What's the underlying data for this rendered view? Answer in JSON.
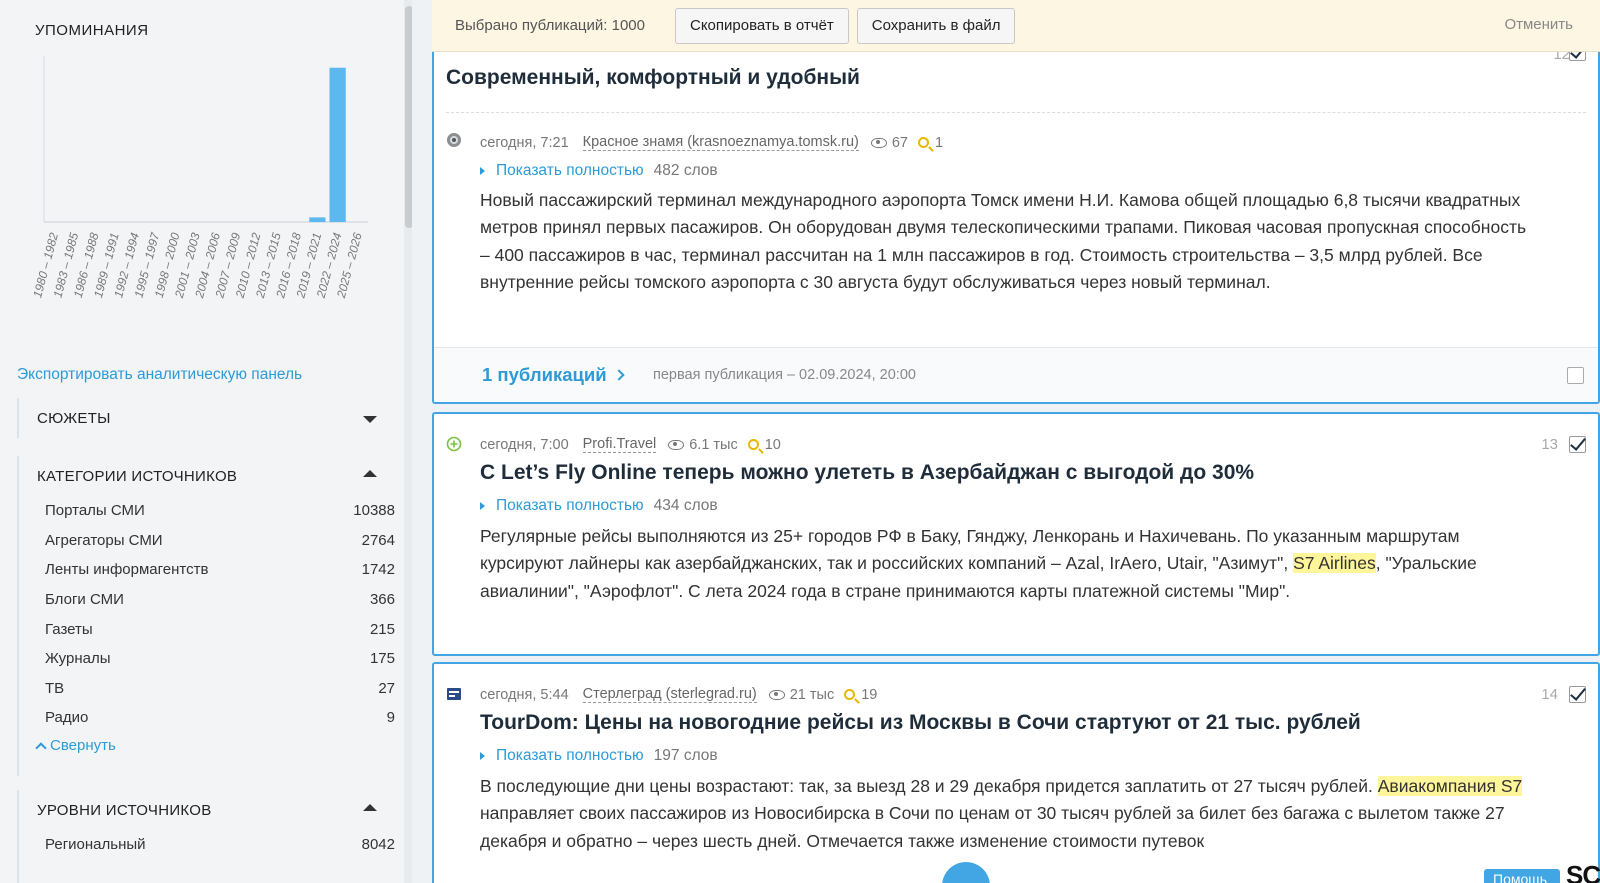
{
  "left": {
    "mentions_title": "УПОМИНАНИЯ",
    "export_link": "Экспортировать аналитическую панель",
    "plots_title": "СЮЖЕТЫ",
    "categories_title": "КАТЕГОРИИ ИСТОЧНИКОВ",
    "categories": [
      {
        "label": "Порталы СМИ",
        "count": "10388"
      },
      {
        "label": "Агрегаторы СМИ",
        "count": "2764"
      },
      {
        "label": "Ленты информагентств",
        "count": "1742"
      },
      {
        "label": "Блоги СМИ",
        "count": "366"
      },
      {
        "label": "Газеты",
        "count": "215"
      },
      {
        "label": "Журналы",
        "count": "175"
      },
      {
        "label": "ТВ",
        "count": "27"
      },
      {
        "label": "Радио",
        "count": "9"
      }
    ],
    "collapse_label": "Свернуть",
    "levels_title": "УРОВНИ ИСТОЧНИКОВ",
    "levels": [
      {
        "label": "Региональный",
        "count": "8042"
      }
    ]
  },
  "chart_data": {
    "type": "bar",
    "title": "",
    "xlabel": "",
    "ylabel": "",
    "categories": [
      "1980 – 1982",
      "1983 – 1985",
      "1986 – 1988",
      "1989 – 1991",
      "1992 – 1994",
      "1995 – 1997",
      "1998 – 2000",
      "2001 – 2003",
      "2004 – 2006",
      "2007 – 2009",
      "2010 – 2012",
      "2013 – 2015",
      "2016 – 2018",
      "2019 – 2021",
      "2022 – 2024",
      "2025 – 2026"
    ],
    "values": [
      0,
      0,
      0,
      0,
      0,
      0,
      0,
      0,
      0,
      0,
      0,
      0,
      0,
      3,
      100,
      0
    ],
    "ylim": [
      0,
      105
    ],
    "color": "#5cb8ee"
  },
  "topbar": {
    "selected": "Выбрано публикаций: 1000",
    "copy_label": "Скопировать в отчёт",
    "save_label": "Сохранить в файл",
    "cancel_label": "Отменить"
  },
  "card1": {
    "number": "12",
    "title": "Современный, комфортный и удобный",
    "time": "сегодня, 7:21",
    "source": "Красное знамя (krasnoeznamya.tomsk.ru)",
    "views": "67",
    "hits": "1",
    "show_full": "Показать полностью",
    "words": "482 слов",
    "text": "Новый пассажирский терминал международного аэропорта Томск имени Н.И. Камова общей площадью 6,8 тысячи квадратных метров принял первых пасажиров. Он оборудован двумя телескопическими трапами. Пиковая часовая пропускная способность – 400 пассажиров в час, терминал рассчитан на 1 млн пассажиров в год. Стоимость строительства – 3,5 млрд рублей. Все внутренние рейсы томского аэропорта с 30 августа будут обслуживаться через новый терминал.",
    "pubs_link": "1 публикаций",
    "first_pub": "первая публикация – 02.09.2024, 20:00"
  },
  "card2": {
    "number": "13",
    "time": "сегодня, 7:00",
    "source": "Profi.Travel",
    "views": "6.1 тыс",
    "hits": "10",
    "title": "С Let’s Fly Online теперь можно улететь в Азербайджан с выгодой до 30%",
    "show_full": "Показать полностью",
    "words": "434 слов",
    "text_a": "Регулярные рейсы выполняются из 25+ городов РФ в Баку, Гянджу, Ленкорань и Нахичевань. По указанным маршрутам курсируют лайнеры как азербайджанских, так и российских компаний – Azal, IrAero, Utair, \"Азимут\", ",
    "text_hl": "S7 Airlines",
    "text_b": ", \"Уральские авиалинии\", \"Аэрофлот\". С лета 2024 года в стране принимаются карты платежной системы \"Мир\"."
  },
  "card3": {
    "number": "14",
    "time": "сегодня, 5:44",
    "source": "Стерлеград (sterlegrad.ru)",
    "views": "21 тыс",
    "hits": "19",
    "title": "TourDom: Цены на новогодние рейсы из Москвы в Сочи стартуют от 21 тыс. рублей",
    "show_full": "Показать полностью",
    "words": "197 слов",
    "text_a": "В последующие дни цены возрастают: так, за выезд 28 и 29 декабря придется заплатить от 27 тысяч рублей. ",
    "text_hl": "Авиакомпания S7",
    "text_b": " направляет своих пассажиров из Новосибирска в Сочи по ценам от 30 тысяч рублей за билет без багажа с вылетом также 27 декабря и обратно – через шесть дней. Отмечается также изменение стоимости путевок"
  },
  "help_label": "Помощь",
  "logo_text": "SCAN"
}
